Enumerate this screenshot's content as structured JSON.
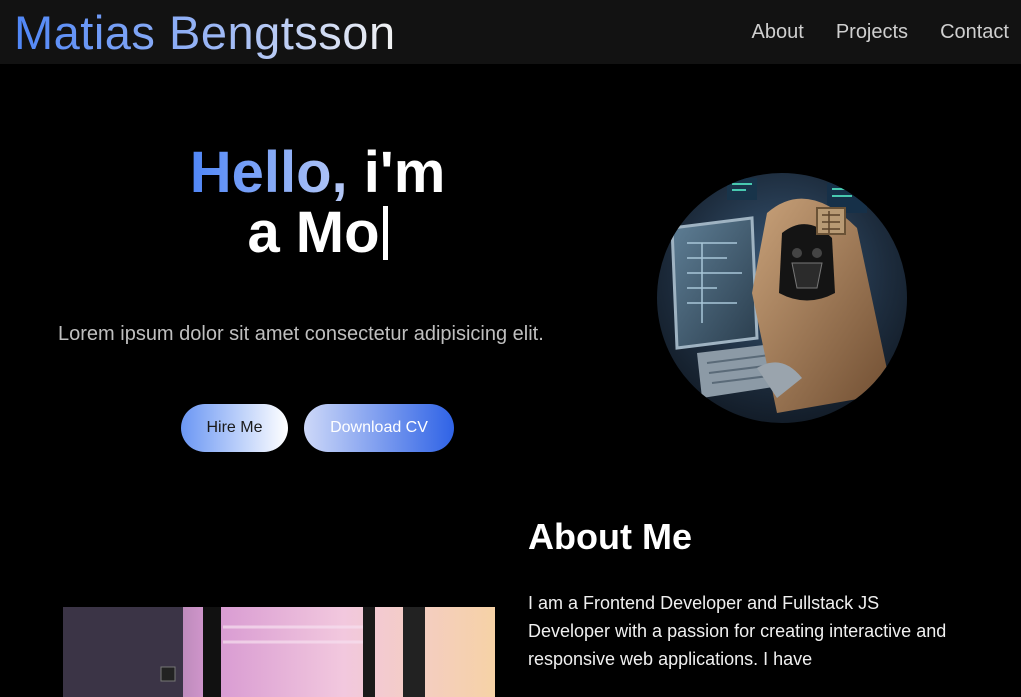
{
  "navbar": {
    "brand": "Matias Bengtsson",
    "links": [
      {
        "label": "About"
      },
      {
        "label": "Projects"
      },
      {
        "label": "Contact"
      }
    ]
  },
  "hero": {
    "greeting": "Hello,",
    "greeting_rest": "i'm",
    "typed_text": "a Mo",
    "subtitle": "Lorem ipsum dolor sit amet consectetur adipisicing elit.",
    "hire_label": "Hire Me",
    "cv_label": "Download CV"
  },
  "about": {
    "title": "About Me",
    "text": "I am a Frontend Developer and Fullstack JS Developer with a passion for creating interactive and responsive web applications. I have"
  },
  "colors": {
    "accent": "#4f86f7",
    "navbar_bg": "#121212",
    "page_bg": "#000000"
  }
}
